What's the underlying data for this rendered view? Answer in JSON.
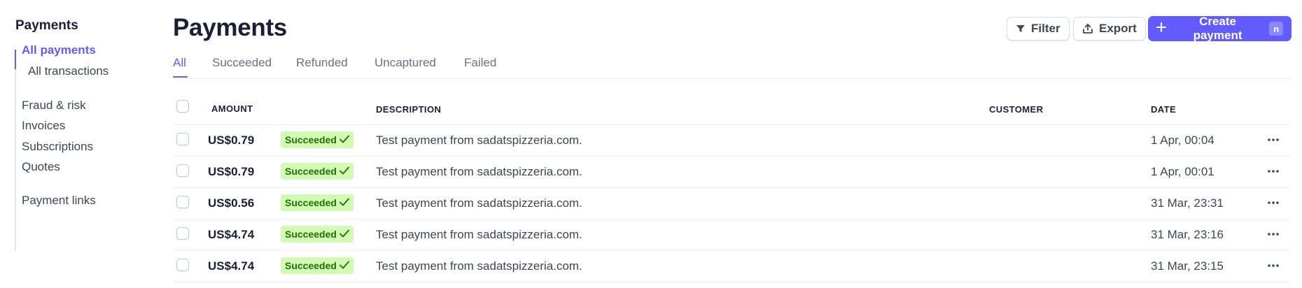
{
  "sidebar": {
    "title": "Payments",
    "items": [
      {
        "label": "All payments",
        "active": true
      },
      {
        "label": "All transactions",
        "active": false
      },
      {
        "label": "Fraud & risk",
        "active": false
      },
      {
        "label": "Invoices",
        "active": false
      },
      {
        "label": "Subscriptions",
        "active": false
      },
      {
        "label": "Quotes",
        "active": false
      },
      {
        "label": "Payment links",
        "active": false
      }
    ]
  },
  "header": {
    "title": "Payments",
    "filter_label": "Filter",
    "export_label": "Export",
    "create_label": "Create payment",
    "create_shortcut": "n"
  },
  "tabs": [
    {
      "label": "All",
      "active": true
    },
    {
      "label": "Succeeded",
      "active": false
    },
    {
      "label": "Refunded",
      "active": false
    },
    {
      "label": "Uncaptured",
      "active": false
    },
    {
      "label": "Failed",
      "active": false
    }
  ],
  "table": {
    "columns": {
      "amount": "AMOUNT",
      "description": "DESCRIPTION",
      "customer": "CUSTOMER",
      "date": "DATE"
    },
    "rows": [
      {
        "amount": "US$0.79",
        "status": "Succeeded",
        "description": "Test payment from sadatspizzeria.com.",
        "customer": "",
        "date": "1 Apr, 00:04"
      },
      {
        "amount": "US$0.79",
        "status": "Succeeded",
        "description": "Test payment from sadatspizzeria.com.",
        "customer": "",
        "date": "1 Apr, 00:01"
      },
      {
        "amount": "US$0.56",
        "status": "Succeeded",
        "description": "Test payment from sadatspizzeria.com.",
        "customer": "",
        "date": "31 Mar, 23:31"
      },
      {
        "amount": "US$4.74",
        "status": "Succeeded",
        "description": "Test payment from sadatspizzeria.com.",
        "customer": "",
        "date": "31 Mar, 23:16"
      },
      {
        "amount": "US$4.74",
        "status": "Succeeded",
        "description": "Test payment from sadatspizzeria.com.",
        "customer": "",
        "date": "31 Mar, 23:15"
      }
    ]
  },
  "colors": {
    "accent": "#635bff",
    "success_bg": "#d1fab3",
    "success_text": "#217005"
  },
  "icons": {
    "filter": "filter-icon",
    "export": "export-icon",
    "create": "plus-icon",
    "status": "check-icon",
    "row_menu": "more-horizontal-icon"
  }
}
